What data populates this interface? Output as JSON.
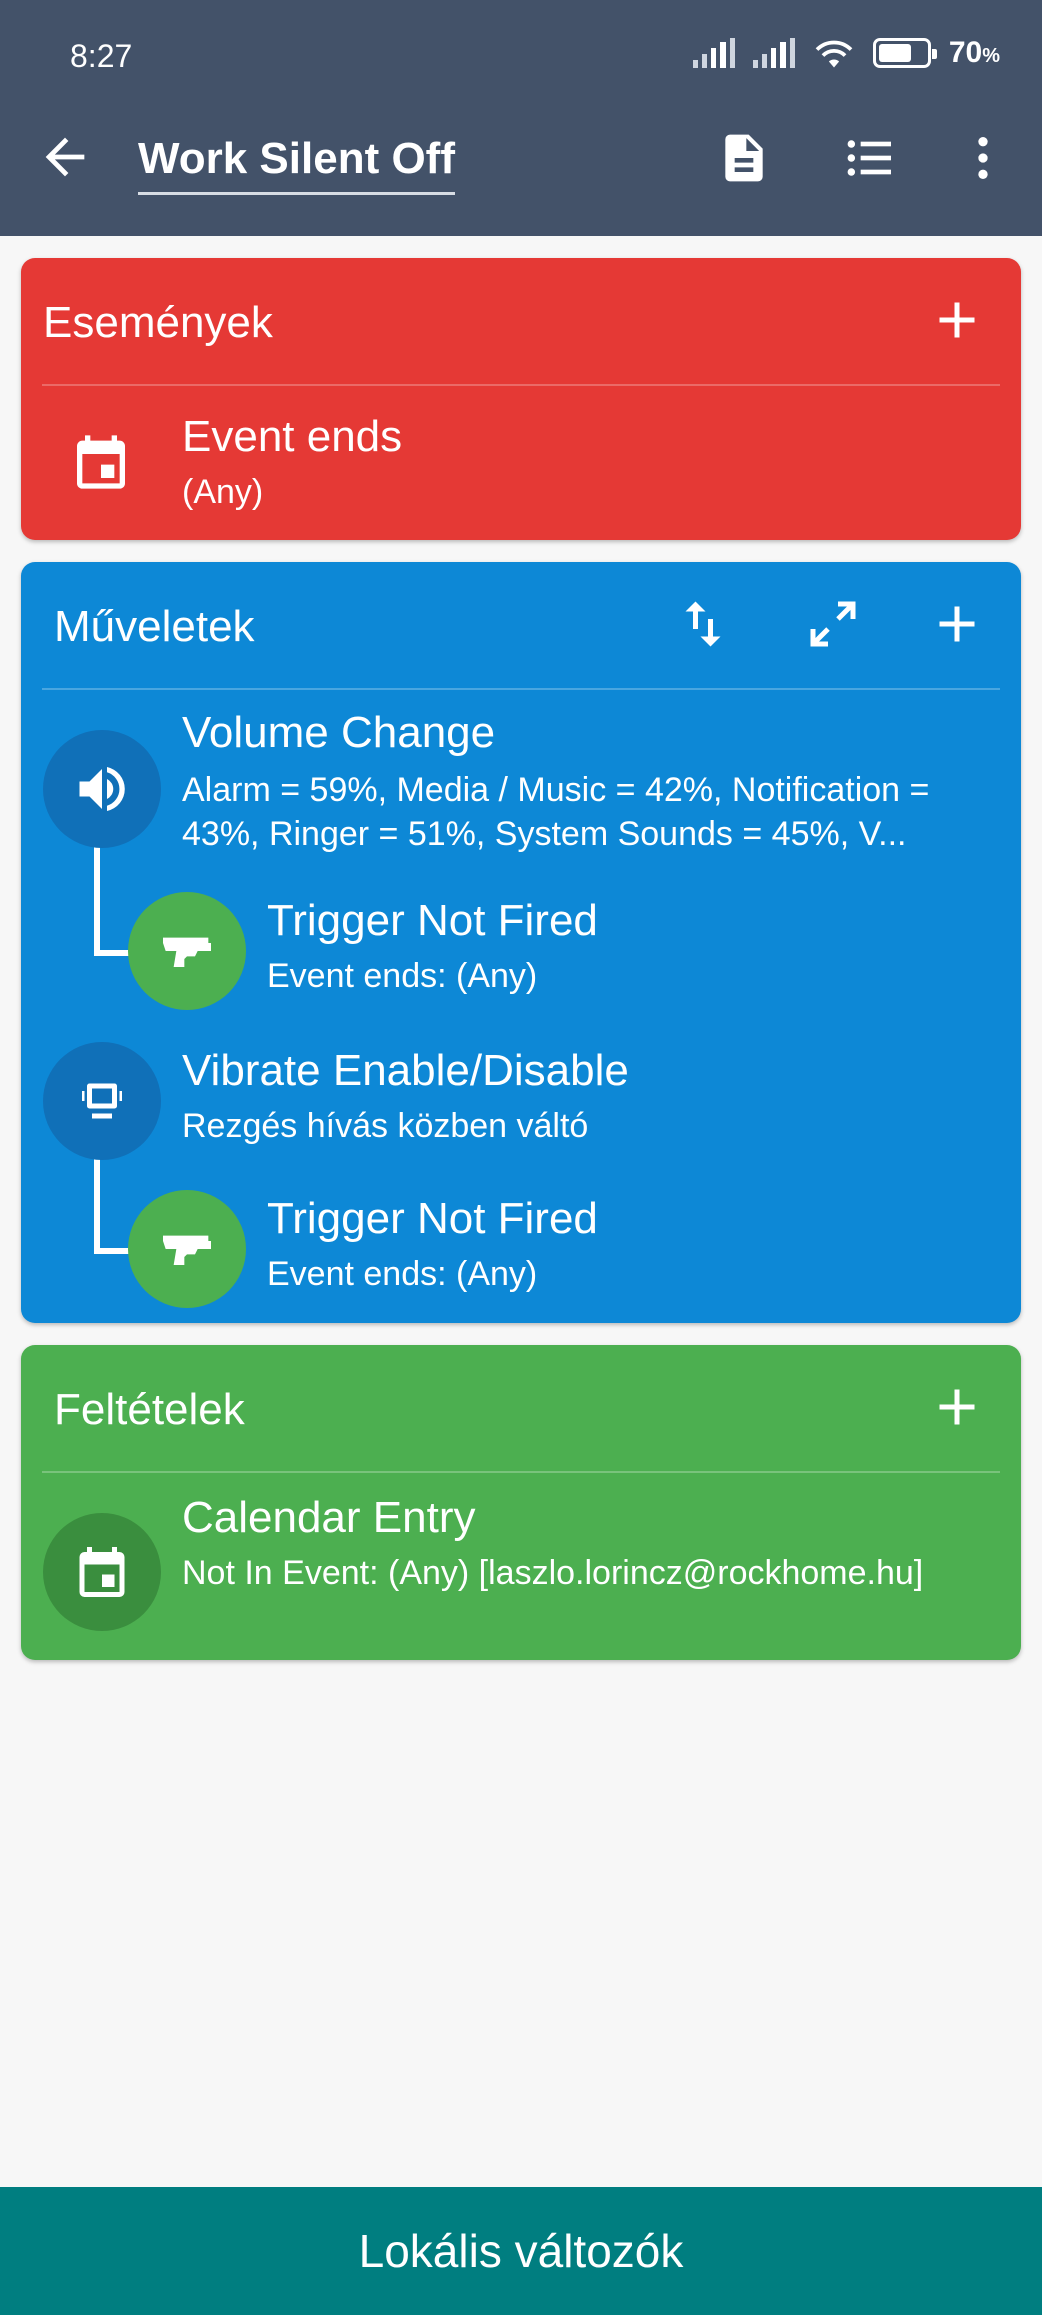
{
  "status_bar": {
    "time": "8:27",
    "battery_percent": "70",
    "battery_unit": "%",
    "battery_level": 0.7
  },
  "app_bar": {
    "title": "Work Silent Off",
    "icons": [
      "back-arrow-icon",
      "document-icon",
      "list-icon",
      "more-vert-icon"
    ]
  },
  "triggers": {
    "header": "Események",
    "color": "#e53935",
    "items": [
      {
        "title": "Event ends",
        "subtitle": "(Any)",
        "icon": "calendar-icon"
      }
    ]
  },
  "actions": {
    "header": "Műveletek",
    "color": "#0d88d6",
    "items": [
      {
        "title": "Volume Change",
        "subtitle": "Alarm = 59%, Media / Music = 42%, Notification = 43%, Ringer = 51%, System Sounds = 45%, V...",
        "icon": "volume-icon",
        "constraint": {
          "title": "Trigger Not Fired",
          "subtitle": "Event ends: (Any)",
          "icon": "gun-icon"
        }
      },
      {
        "title": "Vibrate Enable/Disable",
        "subtitle": "Rezgés hívás közben váltó",
        "icon": "vibrate-icon",
        "constraint": {
          "title": "Trigger Not Fired",
          "subtitle": "Event ends: (Any)",
          "icon": "gun-icon"
        }
      }
    ]
  },
  "conditions": {
    "header": "Feltételek",
    "color": "#4caf50",
    "items": [
      {
        "title": "Calendar Entry",
        "subtitle": "Not In Event: (Any)  [laszlo.lorincz@rockhome.hu]",
        "icon": "calendar-icon"
      }
    ]
  },
  "bottom_bar": {
    "label": "Lokális változók",
    "color": "#007e80"
  }
}
